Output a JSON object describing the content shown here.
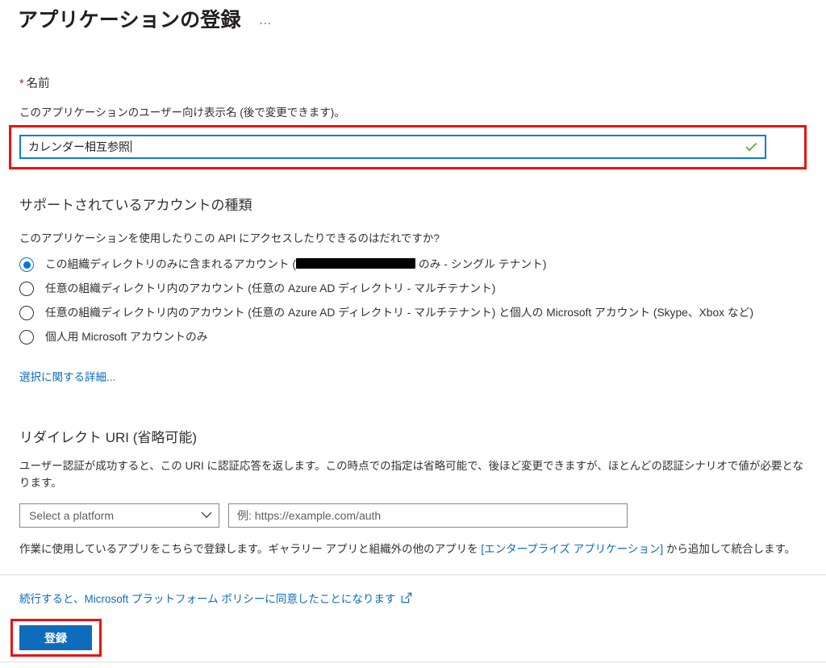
{
  "page": {
    "title": "アプリケーションの登録",
    "ellipsis": "…"
  },
  "name_section": {
    "label": "名前",
    "required_marker": "*",
    "description": "このアプリケーションのユーザー向け表示名 (後で変更できます)。",
    "value": "カレンダー相互参照",
    "valid_icon": "checkmark-icon"
  },
  "account_types": {
    "heading": "サポートされているアカウントの種類",
    "question": "このアプリケーションを使用したりこの API にアクセスしたりできるのはだれですか?",
    "options": [
      {
        "id": "single-tenant",
        "prefix": "この組織ディレクトリのみに含まれるアカウント (",
        "redacted": true,
        "suffix": " のみ - シングル テナント)",
        "selected": true
      },
      {
        "id": "multi-tenant",
        "prefix": "任意の組織ディレクトリ内のアカウント (任意の Azure AD ディレクトリ - マルチテナント)",
        "redacted": false,
        "suffix": "",
        "selected": false
      },
      {
        "id": "multi-tenant-and-personal",
        "prefix": "任意の組織ディレクトリ内のアカウント (任意の Azure AD ディレクトリ - マルチテナント) と個人の Microsoft アカウント (Skype、Xbox など)",
        "redacted": false,
        "suffix": "",
        "selected": false
      },
      {
        "id": "personal-only",
        "prefix": "個人用 Microsoft アカウントのみ",
        "redacted": false,
        "suffix": "",
        "selected": false
      }
    ],
    "help_link": "選択に関する詳細..."
  },
  "redirect_uri": {
    "heading": "リダイレクト URI (省略可能)",
    "description_line1": "ユーザー認証が成功すると、この URI に認証応答を返します。この時点での指定は省略可能で、後ほど変更できますが、ほとんどの認証シナリオで値が必要とな",
    "description_line2": "ります。",
    "platform_select_value": "Select a platform",
    "uri_placeholder": "例: https://example.com/auth",
    "note_before_link": "作業に使用しているアプリをこちらで登録します。ギャラリー アプリと組織外の他のアプリを ",
    "note_link": "[エンタープライズ アプリケーション]",
    "note_after_link": " から追加して統合します。"
  },
  "footer": {
    "policy_text": "続行すると、Microsoft プラットフォーム ポリシーに同意したことになります",
    "policy_external_icon": "external-link-icon",
    "register_label": "登録"
  },
  "colors": {
    "accent": "#0f6cbd",
    "link": "#0f6cbd",
    "highlight_box": "#ee1111",
    "valid_check": "#5bb12f",
    "required_star": "#a4262c",
    "input_focus_border": "#0f7ada"
  }
}
